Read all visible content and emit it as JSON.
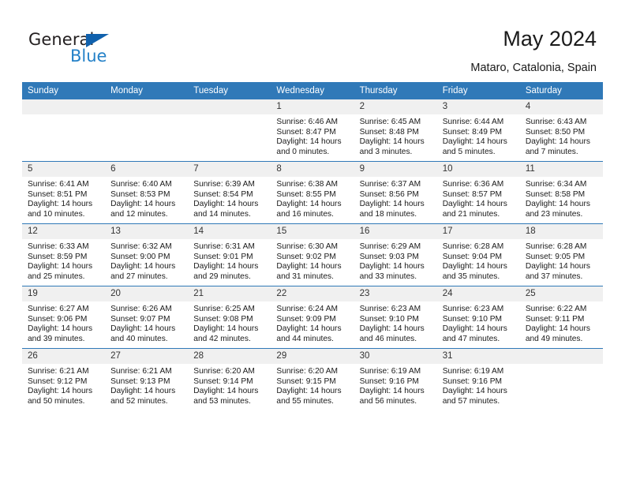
{
  "brand": {
    "name_dark": "General",
    "name_blue": "Blue",
    "color_dark": "#231f20",
    "color_blue": "#2481c8",
    "triangle_color": "#1061ad"
  },
  "header": {
    "title": "May 2024",
    "subtitle": "Mataro, Catalonia, Spain",
    "accent_color": "#3079b8",
    "daynum_band_color": "#f0f0f0"
  },
  "weekdays": [
    "Sunday",
    "Monday",
    "Tuesday",
    "Wednesday",
    "Thursday",
    "Friday",
    "Saturday"
  ],
  "labels": {
    "sunrise": "Sunrise:",
    "sunset": "Sunset:",
    "daylight": "Daylight:"
  },
  "weeks": [
    [
      {
        "day": "",
        "empty": true
      },
      {
        "day": "",
        "empty": true
      },
      {
        "day": "",
        "empty": true
      },
      {
        "day": "1",
        "sunrise": "Sunrise: 6:46 AM",
        "sunset": "Sunset: 8:47 PM",
        "daylight_1": "Daylight: 14 hours",
        "daylight_2": "and 0 minutes."
      },
      {
        "day": "2",
        "sunrise": "Sunrise: 6:45 AM",
        "sunset": "Sunset: 8:48 PM",
        "daylight_1": "Daylight: 14 hours",
        "daylight_2": "and 3 minutes."
      },
      {
        "day": "3",
        "sunrise": "Sunrise: 6:44 AM",
        "sunset": "Sunset: 8:49 PM",
        "daylight_1": "Daylight: 14 hours",
        "daylight_2": "and 5 minutes."
      },
      {
        "day": "4",
        "sunrise": "Sunrise: 6:43 AM",
        "sunset": "Sunset: 8:50 PM",
        "daylight_1": "Daylight: 14 hours",
        "daylight_2": "and 7 minutes."
      }
    ],
    [
      {
        "day": "5",
        "sunrise": "Sunrise: 6:41 AM",
        "sunset": "Sunset: 8:51 PM",
        "daylight_1": "Daylight: 14 hours",
        "daylight_2": "and 10 minutes."
      },
      {
        "day": "6",
        "sunrise": "Sunrise: 6:40 AM",
        "sunset": "Sunset: 8:53 PM",
        "daylight_1": "Daylight: 14 hours",
        "daylight_2": "and 12 minutes."
      },
      {
        "day": "7",
        "sunrise": "Sunrise: 6:39 AM",
        "sunset": "Sunset: 8:54 PM",
        "daylight_1": "Daylight: 14 hours",
        "daylight_2": "and 14 minutes."
      },
      {
        "day": "8",
        "sunrise": "Sunrise: 6:38 AM",
        "sunset": "Sunset: 8:55 PM",
        "daylight_1": "Daylight: 14 hours",
        "daylight_2": "and 16 minutes."
      },
      {
        "day": "9",
        "sunrise": "Sunrise: 6:37 AM",
        "sunset": "Sunset: 8:56 PM",
        "daylight_1": "Daylight: 14 hours",
        "daylight_2": "and 18 minutes."
      },
      {
        "day": "10",
        "sunrise": "Sunrise: 6:36 AM",
        "sunset": "Sunset: 8:57 PM",
        "daylight_1": "Daylight: 14 hours",
        "daylight_2": "and 21 minutes."
      },
      {
        "day": "11",
        "sunrise": "Sunrise: 6:34 AM",
        "sunset": "Sunset: 8:58 PM",
        "daylight_1": "Daylight: 14 hours",
        "daylight_2": "and 23 minutes."
      }
    ],
    [
      {
        "day": "12",
        "sunrise": "Sunrise: 6:33 AM",
        "sunset": "Sunset: 8:59 PM",
        "daylight_1": "Daylight: 14 hours",
        "daylight_2": "and 25 minutes."
      },
      {
        "day": "13",
        "sunrise": "Sunrise: 6:32 AM",
        "sunset": "Sunset: 9:00 PM",
        "daylight_1": "Daylight: 14 hours",
        "daylight_2": "and 27 minutes."
      },
      {
        "day": "14",
        "sunrise": "Sunrise: 6:31 AM",
        "sunset": "Sunset: 9:01 PM",
        "daylight_1": "Daylight: 14 hours",
        "daylight_2": "and 29 minutes."
      },
      {
        "day": "15",
        "sunrise": "Sunrise: 6:30 AM",
        "sunset": "Sunset: 9:02 PM",
        "daylight_1": "Daylight: 14 hours",
        "daylight_2": "and 31 minutes."
      },
      {
        "day": "16",
        "sunrise": "Sunrise: 6:29 AM",
        "sunset": "Sunset: 9:03 PM",
        "daylight_1": "Daylight: 14 hours",
        "daylight_2": "and 33 minutes."
      },
      {
        "day": "17",
        "sunrise": "Sunrise: 6:28 AM",
        "sunset": "Sunset: 9:04 PM",
        "daylight_1": "Daylight: 14 hours",
        "daylight_2": "and 35 minutes."
      },
      {
        "day": "18",
        "sunrise": "Sunrise: 6:28 AM",
        "sunset": "Sunset: 9:05 PM",
        "daylight_1": "Daylight: 14 hours",
        "daylight_2": "and 37 minutes."
      }
    ],
    [
      {
        "day": "19",
        "sunrise": "Sunrise: 6:27 AM",
        "sunset": "Sunset: 9:06 PM",
        "daylight_1": "Daylight: 14 hours",
        "daylight_2": "and 39 minutes."
      },
      {
        "day": "20",
        "sunrise": "Sunrise: 6:26 AM",
        "sunset": "Sunset: 9:07 PM",
        "daylight_1": "Daylight: 14 hours",
        "daylight_2": "and 40 minutes."
      },
      {
        "day": "21",
        "sunrise": "Sunrise: 6:25 AM",
        "sunset": "Sunset: 9:08 PM",
        "daylight_1": "Daylight: 14 hours",
        "daylight_2": "and 42 minutes."
      },
      {
        "day": "22",
        "sunrise": "Sunrise: 6:24 AM",
        "sunset": "Sunset: 9:09 PM",
        "daylight_1": "Daylight: 14 hours",
        "daylight_2": "and 44 minutes."
      },
      {
        "day": "23",
        "sunrise": "Sunrise: 6:23 AM",
        "sunset": "Sunset: 9:10 PM",
        "daylight_1": "Daylight: 14 hours",
        "daylight_2": "and 46 minutes."
      },
      {
        "day": "24",
        "sunrise": "Sunrise: 6:23 AM",
        "sunset": "Sunset: 9:10 PM",
        "daylight_1": "Daylight: 14 hours",
        "daylight_2": "and 47 minutes."
      },
      {
        "day": "25",
        "sunrise": "Sunrise: 6:22 AM",
        "sunset": "Sunset: 9:11 PM",
        "daylight_1": "Daylight: 14 hours",
        "daylight_2": "and 49 minutes."
      }
    ],
    [
      {
        "day": "26",
        "sunrise": "Sunrise: 6:21 AM",
        "sunset": "Sunset: 9:12 PM",
        "daylight_1": "Daylight: 14 hours",
        "daylight_2": "and 50 minutes."
      },
      {
        "day": "27",
        "sunrise": "Sunrise: 6:21 AM",
        "sunset": "Sunset: 9:13 PM",
        "daylight_1": "Daylight: 14 hours",
        "daylight_2": "and 52 minutes."
      },
      {
        "day": "28",
        "sunrise": "Sunrise: 6:20 AM",
        "sunset": "Sunset: 9:14 PM",
        "daylight_1": "Daylight: 14 hours",
        "daylight_2": "and 53 minutes."
      },
      {
        "day": "29",
        "sunrise": "Sunrise: 6:20 AM",
        "sunset": "Sunset: 9:15 PM",
        "daylight_1": "Daylight: 14 hours",
        "daylight_2": "and 55 minutes."
      },
      {
        "day": "30",
        "sunrise": "Sunrise: 6:19 AM",
        "sunset": "Sunset: 9:16 PM",
        "daylight_1": "Daylight: 14 hours",
        "daylight_2": "and 56 minutes."
      },
      {
        "day": "31",
        "sunrise": "Sunrise: 6:19 AM",
        "sunset": "Sunset: 9:16 PM",
        "daylight_1": "Daylight: 14 hours",
        "daylight_2": "and 57 minutes."
      },
      {
        "day": "",
        "empty": true
      }
    ]
  ]
}
